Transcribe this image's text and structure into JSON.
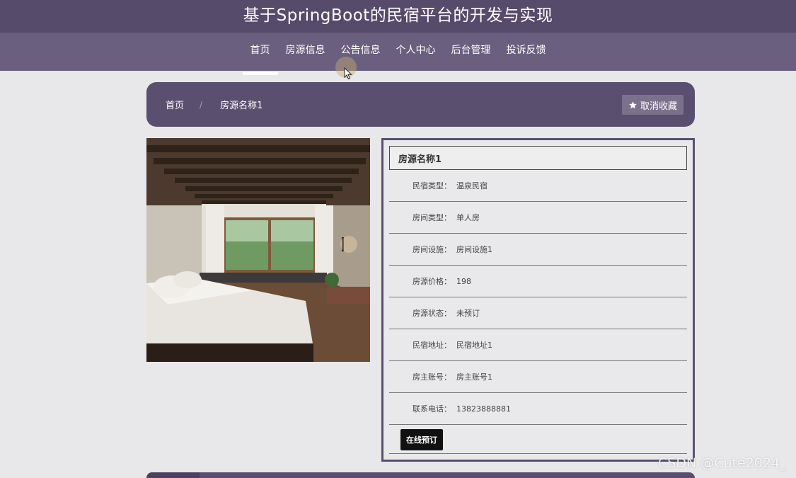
{
  "site": {
    "title": "基于SpringBoot的民宿平台的开发与实现"
  },
  "nav": {
    "items": [
      {
        "label": "首页"
      },
      {
        "label": "房源信息"
      },
      {
        "label": "公告信息"
      },
      {
        "label": "个人中心"
      },
      {
        "label": "后台管理"
      },
      {
        "label": "投诉反馈"
      }
    ],
    "active_index": 0
  },
  "breadcrumb": {
    "home": "首页",
    "separator": "/",
    "current": "房源名称1",
    "unfavorite_label": "取消收藏",
    "unfavorite_icon": "star-icon"
  },
  "detail": {
    "title": "房源名称1",
    "fields": [
      {
        "label": "民宿类型：",
        "value": "温泉民宿"
      },
      {
        "label": "房间类型：",
        "value": "单人房"
      },
      {
        "label": "房间设施：",
        "value": "房间设施1"
      },
      {
        "label": "房源价格：",
        "value": "198"
      },
      {
        "label": "房源状态：",
        "value": "未预订"
      },
      {
        "label": "民宿地址：",
        "value": "民宿地址1"
      },
      {
        "label": "房主账号：",
        "value": "房主账号1"
      },
      {
        "label": "联系电话：",
        "value": "13823888881"
      }
    ],
    "book_label": "在线预订"
  },
  "watermark": "CSDN @Cute2024_",
  "colors": {
    "header": "#574b6b",
    "nav": "#6a5f7e",
    "breadcrumb": "#5b4f70",
    "page_bg": "#e8e7e9"
  }
}
